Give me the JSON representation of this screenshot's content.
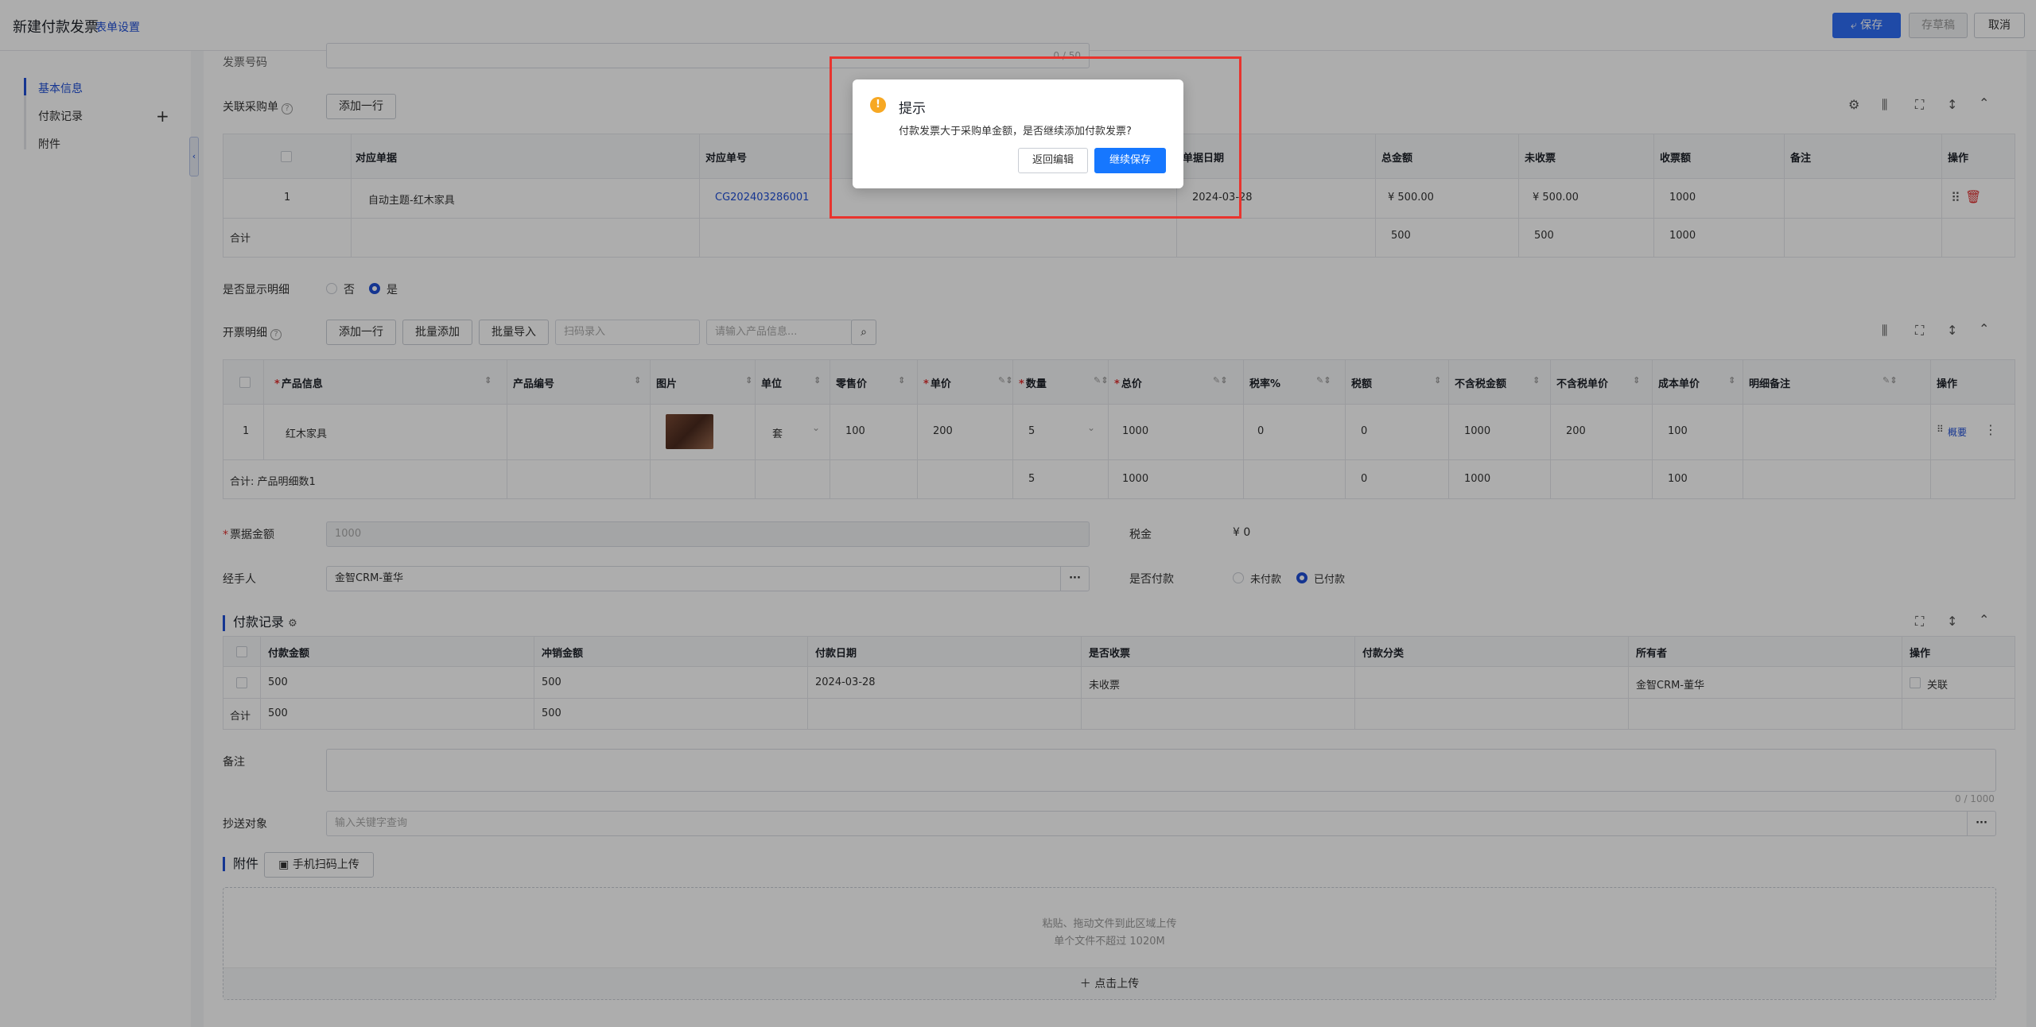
{
  "header": {
    "title": "新建付款发票",
    "form_setting": "表单设置",
    "save": "保存",
    "draft": "存草稿",
    "cancel": "取消"
  },
  "nav": {
    "items": [
      "基本信息",
      "付款记录",
      "附件"
    ]
  },
  "invoice_no": {
    "label": "发票号码",
    "counter": "0 / 50"
  },
  "purchase": {
    "label": "关联采购单",
    "add_row": "添加一行",
    "headers": [
      "对应单据",
      "对应单号",
      "单据日期",
      "总金额",
      "未收票",
      "收票额",
      "备注",
      "操作"
    ],
    "row": {
      "index": "1",
      "doc": "自动主题-红木家具",
      "doc_no": "CG202403286001",
      "date": "2024-03-28",
      "total": "¥ 500.00",
      "uninvoiced": "¥ 500.00",
      "received": "1000"
    },
    "sum": {
      "label": "合计",
      "total": "500",
      "uninvoiced": "500",
      "received": "1000"
    }
  },
  "show_detail": {
    "label": "是否显示明细",
    "no": "否",
    "yes": "是"
  },
  "detail": {
    "label": "开票明细",
    "add_row": "添加一行",
    "batch_add": "批量添加",
    "batch_import": "批量导入",
    "scan_placeholder": "扫码录入",
    "search_placeholder": "请输入产品信息...",
    "headers": [
      "产品信息",
      "产品编号",
      "图片",
      "单位",
      "零售价",
      "单价",
      "数量",
      "总价",
      "税率%",
      "税额",
      "不含税金额",
      "不含税单价",
      "成本单价",
      "明细备注",
      "操作"
    ],
    "row": {
      "index": "1",
      "product": "红木家具",
      "unit": "套",
      "retail": "100",
      "price": "200",
      "qty": "5",
      "total": "1000",
      "tax_rate": "0",
      "tax": "0",
      "net": "1000",
      "net_price": "200",
      "cost": "100",
      "op": "概要"
    },
    "sum": {
      "label": "合计: 产品明细数1",
      "qty": "5",
      "total": "1000",
      "tax": "0",
      "net": "1000",
      "cost": "100"
    }
  },
  "amount": {
    "label": "票据金额",
    "placeholder": "1000",
    "tax_label": "税金",
    "tax_value": "¥ 0"
  },
  "handler": {
    "label": "经手人",
    "value": "金智CRM-董华",
    "paid_label": "是否付款",
    "unpaid": "未付款",
    "paid": "已付款"
  },
  "payment": {
    "title": "付款记录",
    "headers": [
      "付款金额",
      "冲销金额",
      "付款日期",
      "是否收票",
      "付款分类",
      "所有者",
      "操作"
    ],
    "row": {
      "amount": "500",
      "offset": "500",
      "date": "2024-03-28",
      "received": "未收票",
      "owner": "金智CRM-董华",
      "op": "关联"
    },
    "sum": {
      "label": "合计",
      "amount": "500",
      "offset": "500"
    }
  },
  "remark": {
    "label": "备注",
    "counter": "0 / 1000"
  },
  "cc": {
    "label": "抄送对象",
    "placeholder": "输入关键字查询"
  },
  "attachment": {
    "title": "附件",
    "scan_upload": "手机扫码上传",
    "drop_line1": "粘贴、拖动文件到此区域上传",
    "drop_line2": "单个文件不超过 1020M",
    "click_upload": "点击上传"
  },
  "modal": {
    "title": "提示",
    "message": "付款发票大于采购单金额，是否继续添加付款发票?",
    "back": "返回编辑",
    "continue": "继续保存"
  }
}
